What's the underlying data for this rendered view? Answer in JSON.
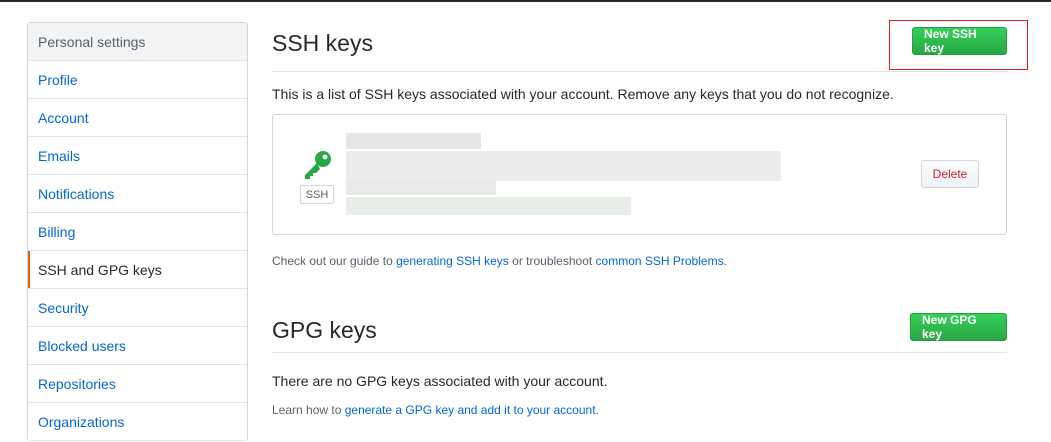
{
  "sidebar": {
    "header": "Personal settings",
    "items": [
      {
        "label": "Profile",
        "selected": false
      },
      {
        "label": "Account",
        "selected": false
      },
      {
        "label": "Emails",
        "selected": false
      },
      {
        "label": "Notifications",
        "selected": false
      },
      {
        "label": "Billing",
        "selected": false
      },
      {
        "label": "SSH and GPG keys",
        "selected": true
      },
      {
        "label": "Security",
        "selected": false
      },
      {
        "label": "Blocked users",
        "selected": false
      },
      {
        "label": "Repositories",
        "selected": false
      },
      {
        "label": "Organizations",
        "selected": false
      }
    ]
  },
  "ssh": {
    "title": "SSH keys",
    "new_button": "New SSH key",
    "intro": "This is a list of SSH keys associated with your account. Remove any keys that you do not recognize.",
    "key_type_label": "SSH",
    "delete_button": "Delete",
    "guide_prefix": "Check out our guide to ",
    "guide_link1": "generating SSH keys",
    "guide_middle": " or troubleshoot ",
    "guide_link2": "common SSH Problems",
    "guide_suffix": "."
  },
  "gpg": {
    "title": "GPG keys",
    "new_button": "New GPG key",
    "empty_text": "There are no GPG keys associated with your account.",
    "learn_prefix": "Learn how to ",
    "learn_link": "generate a GPG key and add it to your account",
    "learn_suffix": "."
  },
  "colors": {
    "accent_green": "#28a745",
    "link_blue": "#0366d6",
    "selected_indicator": "#e36209",
    "highlight_box": "#e0201f",
    "delete_red": "#cb2431"
  },
  "icons": {
    "key_icon": "key-icon"
  }
}
